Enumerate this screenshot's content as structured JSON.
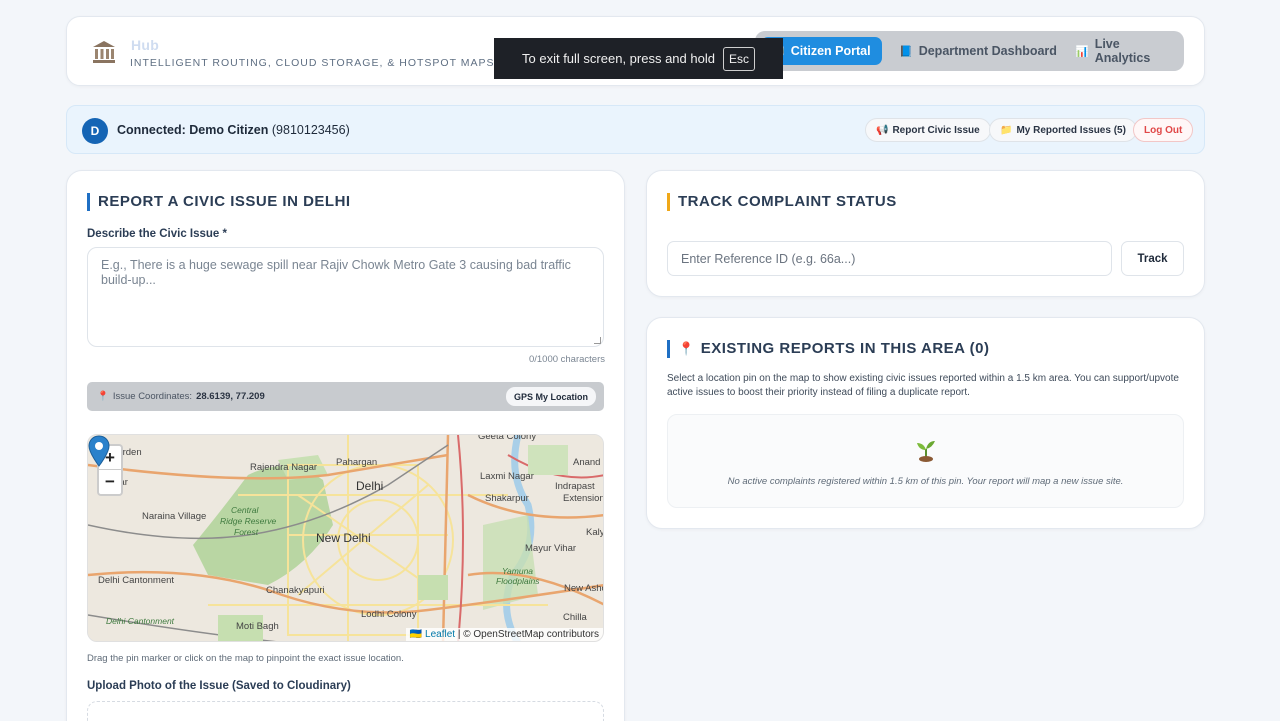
{
  "header": {
    "brand_title": "Hub",
    "brand_subtitle": "INTELLIGENT ROUTING, CLOUD STORAGE, & HOTSPOT MAPS",
    "tabs": [
      {
        "label": "Citizen Portal",
        "icon": "megaphone-icon",
        "active": true
      },
      {
        "label": "Department Dashboard",
        "icon": "book-icon",
        "active": false
      },
      {
        "label": "Live Analytics",
        "icon": "bar-chart-icon",
        "active": false
      }
    ]
  },
  "fullscreen_toast": {
    "text": "To exit full screen, press and hold",
    "key": "Esc"
  },
  "connection": {
    "avatar_letter": "D",
    "prefix": "Connected: Demo Citizen",
    "phone": "(9810123456)",
    "buttons": {
      "report": "Report Civic Issue",
      "my_issues": "My Reported Issues (5)",
      "logout": "Log Out"
    }
  },
  "report": {
    "title": "REPORT A CIVIC ISSUE IN DELHI",
    "describe_label": "Describe the Civic Issue *",
    "describe_placeholder": "E.g., There is a huge sewage spill near Rajiv Chowk Metro Gate 3 causing bad traffic build-up...",
    "char_count": "0/1000 characters",
    "coords_label": "Issue Coordinates:",
    "coords_value": "28.6139, 77.209",
    "gps_button": "GPS My Location",
    "map": {
      "zoom_in": "+",
      "zoom_out": "−",
      "labels": {
        "geeta": "Geeta Colony",
        "garden": "ri Garden",
        "rajendra": "Rajendra Nagar",
        "pahar": "Pahargan",
        "delhi": "Delhi",
        "laxmi": "Laxmi Nagar",
        "anand": "Anand",
        "indra": "Indrapast",
        "ext": "Extension",
        "nagar": "Nagar",
        "naraina": "Naraina Village",
        "central": "Central",
        "ridge": "Ridge Reserve",
        "forest": "Forest",
        "shakarpur": "Shakarpur",
        "newdelhi": "New Delhi",
        "kaly": "Kaly",
        "mayur": "Mayur Vihar",
        "yamuna": "Yamuna",
        "flood": "Floodplains",
        "cant": "Delhi Cantonment",
        "chanak": "Chanakyapuri",
        "newash": "New Asho",
        "cant2": "Delhi Cantonment",
        "lodhi": "Lodhi Colony",
        "moti": "Moti Bagh",
        "chilla": "Chilla"
      },
      "attribution_link": "Leaflet",
      "attribution_text": "| © OpenStreetMap contributors"
    },
    "drag_hint": "Drag the pin marker or click on the map to pinpoint the exact issue location.",
    "upload_label": "Upload Photo of the Issue (Saved to Cloudinary)"
  },
  "track": {
    "title": "TRACK COMPLAINT STATUS",
    "input_placeholder": "Enter Reference ID (e.g. 66a...)",
    "button": "Track"
  },
  "existing": {
    "title": "EXISTING REPORTS IN THIS AREA (0)",
    "description": "Select a location pin on the map to show existing civic issues reported within a 1.5 km area. You can support/upvote active issues to boost their priority instead of filing a duplicate report.",
    "empty_text": "No active complaints registered within 1.5 km of this pin. Your report will map a new issue site."
  },
  "colors": {
    "accent": "#1f8de0",
    "brand_dark": "#1565b5",
    "title_bar": "#1f6fc4",
    "track_bar": "#f0a818",
    "logout": "#e04848"
  }
}
